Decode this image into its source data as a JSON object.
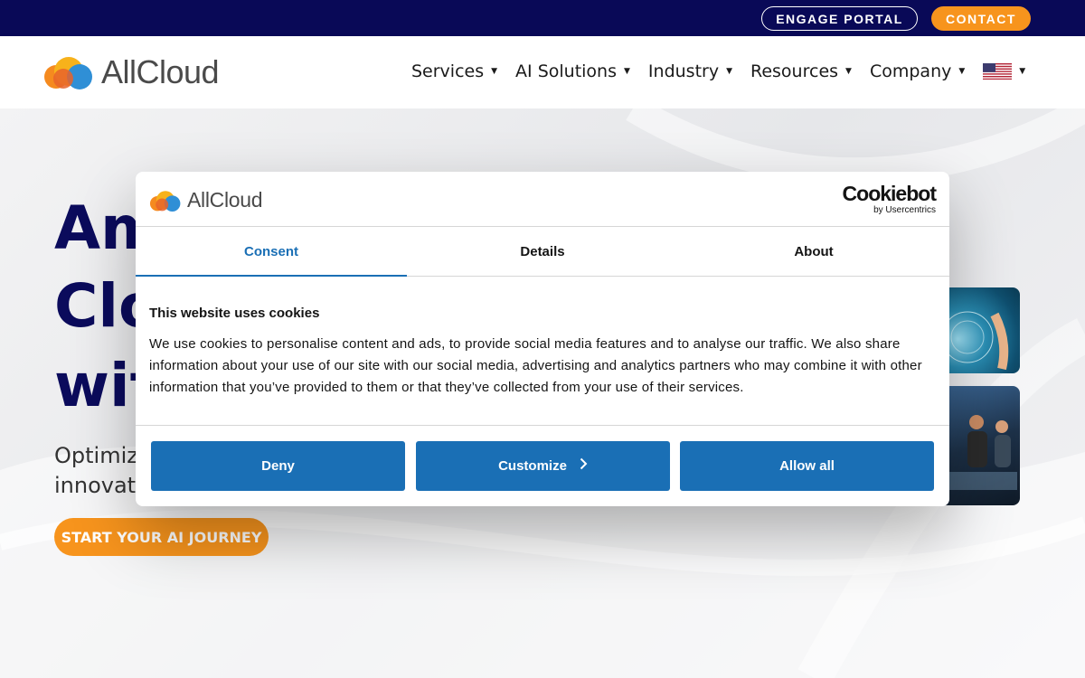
{
  "topbar": {
    "engage_label": "ENGAGE PORTAL",
    "contact_label": "CONTACT"
  },
  "header": {
    "logo_text": "AllCloud",
    "nav": [
      {
        "label": "Services"
      },
      {
        "label": "AI Solutions"
      },
      {
        "label": "Industry"
      },
      {
        "label": "Resources"
      },
      {
        "label": "Company"
      }
    ],
    "language_icon": "us-flag-icon"
  },
  "hero": {
    "title_lines": [
      "Am",
      "Clo",
      "wit"
    ],
    "subtitle_lines": [
      "Optimize",
      "innovatio"
    ],
    "cta_label": "START YOUR AI JOURNEY"
  },
  "cookie_dialog": {
    "logo_text": "AllCloud",
    "cookiebot_main": "Cookiebot",
    "cookiebot_by": "by Usercentrics",
    "tabs": [
      {
        "label": "Consent",
        "active": true
      },
      {
        "label": "Details",
        "active": false
      },
      {
        "label": "About",
        "active": false
      }
    ],
    "heading": "This website uses cookies",
    "body": "We use cookies to personalise content and ads, to provide social media features and to analyse our traffic. We also share information about your use of our site with our social media, advertising and analytics partners who may combine it with other information that you’ve provided to them or that they’ve collected from your use of their services.",
    "deny_label": "Deny",
    "customize_label": "Customize",
    "allow_label": "Allow all"
  },
  "colors": {
    "navy": "#090957",
    "orange": "#f7941d",
    "cookie_blue": "#1a6fb5"
  }
}
